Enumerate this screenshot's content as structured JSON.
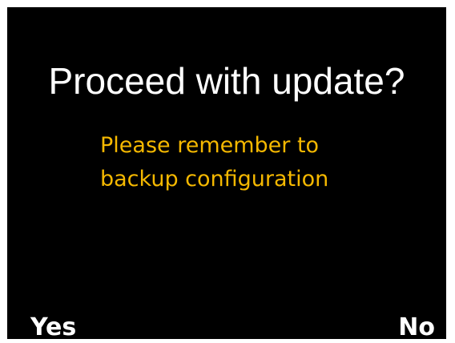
{
  "dialog": {
    "title": "Proceed with update?",
    "message_lines": [
      "Please remember to",
      "backup configuration"
    ]
  },
  "softkeys": {
    "left_label": "Yes",
    "right_label": "No"
  },
  "colors": {
    "background": "#000000",
    "title": "#ffffff",
    "message": "#f5b800",
    "softkeys": "#ffffff"
  }
}
